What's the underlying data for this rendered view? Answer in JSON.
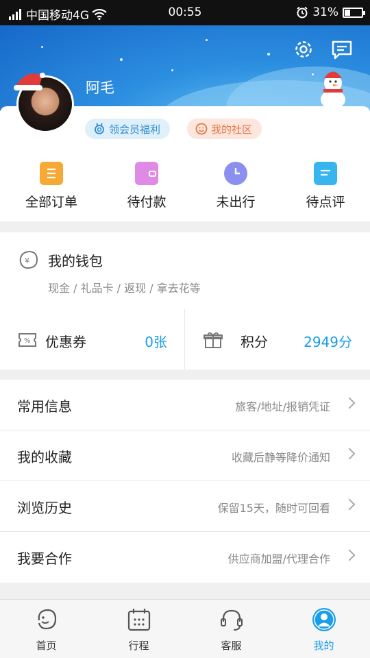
{
  "status": {
    "carrier": "中国移动4G",
    "time": "00:55",
    "battery": "31%"
  },
  "profile": {
    "name": "阿毛"
  },
  "pills": {
    "member": "领会员福利",
    "community": "我的社区"
  },
  "orders": [
    {
      "label": "全部订单",
      "icon": "order-list-icon",
      "color": "#f7a936"
    },
    {
      "label": "待付款",
      "icon": "wallet-icon",
      "color": "#e08ae8"
    },
    {
      "label": "未出行",
      "icon": "clock-icon",
      "color": "#8a8ff0"
    },
    {
      "label": "待点评",
      "icon": "comment-icon",
      "color": "#37b5ef"
    }
  ],
  "wallet": {
    "title": "我的钱包",
    "subtitle": "现金 / 礼品卡 / 返现 / 拿去花等",
    "coupon_label": "优惠券",
    "coupon_value": "0张",
    "points_label": "积分",
    "points_value": "2949分"
  },
  "menu": [
    {
      "name": "常用信息",
      "hint": "旅客/地址/报销凭证"
    },
    {
      "name": "我的收藏",
      "hint": "收藏后静等降价通知"
    },
    {
      "name": "浏览历史",
      "hint": "保留15天，随时可回看"
    },
    {
      "name": "我要合作",
      "hint": "供应商加盟/代理合作"
    }
  ],
  "tabs": [
    {
      "label": "首页",
      "icon": "dolphin-home-icon"
    },
    {
      "label": "行程",
      "icon": "calendar-icon"
    },
    {
      "label": "客服",
      "icon": "headset-icon"
    },
    {
      "label": "我的",
      "icon": "user-icon",
      "active": true
    }
  ],
  "colors": {
    "accent": "#1a9ee8",
    "header": "#2c8fe0"
  }
}
